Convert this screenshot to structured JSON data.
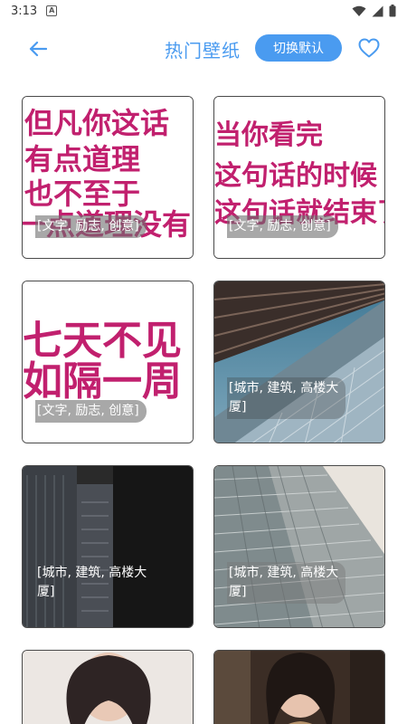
{
  "status_bar": {
    "time": "3:13",
    "app_icon": "A"
  },
  "header": {
    "title": "热门壁纸",
    "switch_label": "切换默认"
  },
  "cards": [
    {
      "lines": [
        "但凡你这话",
        "有点道理",
        "也不至于",
        "一点道理没有"
      ],
      "tag": "[文字, 励志, 创意]"
    },
    {
      "lines": [
        "当你看完",
        "这句话的时候",
        "这句话就结束了"
      ],
      "tag": "[文字, 励志, 创意]"
    },
    {
      "lines": [
        "七天不见",
        "如隔一周"
      ],
      "tag": "[文字, 励志, 创意]"
    },
    {
      "tag_line1": "[城市, 建筑, 高楼大",
      "tag_line2": "厦]"
    },
    {
      "tag_line1": "[城市, 建筑, 高楼大",
      "tag_line2": "厦]"
    },
    {
      "tag_line1": "[城市, 建筑, 高楼大",
      "tag_line2": "厦]"
    }
  ],
  "colors": {
    "accent": "#4a9bf0",
    "quote_text": "#c1206e"
  }
}
